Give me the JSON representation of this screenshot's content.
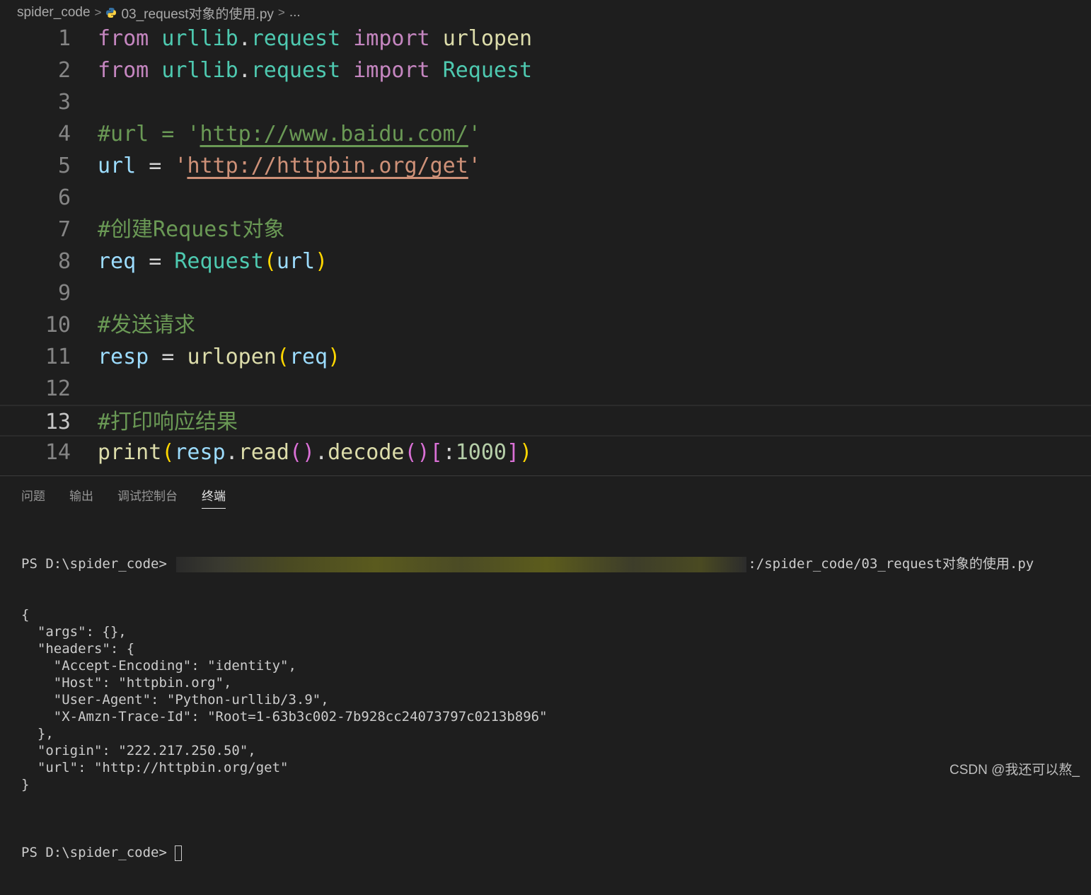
{
  "breadcrumb": {
    "folder": "spider_code",
    "file": "03_request对象的使用.py",
    "more": "...",
    "separator": ">"
  },
  "editor": {
    "current_line": 13,
    "lines": [
      {
        "n": "1",
        "tokens": [
          {
            "t": "from",
            "c": "k"
          },
          {
            "t": " "
          },
          {
            "t": "urllib",
            "c": "m"
          },
          {
            "t": "."
          },
          {
            "t": "request",
            "c": "m"
          },
          {
            "t": " "
          },
          {
            "t": "import",
            "c": "k"
          },
          {
            "t": " "
          },
          {
            "t": "urlopen",
            "c": "f"
          }
        ]
      },
      {
        "n": "2",
        "tokens": [
          {
            "t": "from",
            "c": "k"
          },
          {
            "t": " "
          },
          {
            "t": "urllib",
            "c": "m"
          },
          {
            "t": "."
          },
          {
            "t": "request",
            "c": "m"
          },
          {
            "t": " "
          },
          {
            "t": "import",
            "c": "k"
          },
          {
            "t": " "
          },
          {
            "t": "Request",
            "c": "m"
          }
        ]
      },
      {
        "n": "3",
        "tokens": []
      },
      {
        "n": "4",
        "tokens": [
          {
            "t": "#url = '",
            "c": "c"
          },
          {
            "t": "http://www.baidu.com/",
            "c": "c link-g"
          },
          {
            "t": "'",
            "c": "c"
          }
        ]
      },
      {
        "n": "5",
        "tokens": [
          {
            "t": "url",
            "c": "v"
          },
          {
            "t": " = "
          },
          {
            "t": "'",
            "c": "s"
          },
          {
            "t": "http://httpbin.org/get",
            "c": "s link-s"
          },
          {
            "t": "'",
            "c": "s"
          }
        ]
      },
      {
        "n": "6",
        "tokens": []
      },
      {
        "n": "7",
        "tokens": [
          {
            "t": "#创建Request对象",
            "c": "c"
          }
        ]
      },
      {
        "n": "8",
        "tokens": [
          {
            "t": "req",
            "c": "v"
          },
          {
            "t": " = "
          },
          {
            "t": "Request",
            "c": "m"
          },
          {
            "t": "(",
            "c": "p1"
          },
          {
            "t": "url",
            "c": "v"
          },
          {
            "t": ")",
            "c": "p1"
          }
        ]
      },
      {
        "n": "9",
        "tokens": []
      },
      {
        "n": "10",
        "tokens": [
          {
            "t": "#发送请求",
            "c": "c"
          }
        ]
      },
      {
        "n": "11",
        "tokens": [
          {
            "t": "resp",
            "c": "v"
          },
          {
            "t": " = "
          },
          {
            "t": "urlopen",
            "c": "f"
          },
          {
            "t": "(",
            "c": "p1"
          },
          {
            "t": "req",
            "c": "v"
          },
          {
            "t": ")",
            "c": "p1"
          }
        ]
      },
      {
        "n": "12",
        "tokens": []
      },
      {
        "n": "13",
        "tokens": [
          {
            "t": "#打印响应结果",
            "c": "c"
          }
        ]
      },
      {
        "n": "14",
        "tokens": [
          {
            "t": "print",
            "c": "f"
          },
          {
            "t": "(",
            "c": "p1"
          },
          {
            "t": "resp",
            "c": "v"
          },
          {
            "t": "."
          },
          {
            "t": "read",
            "c": "f"
          },
          {
            "t": "()",
            "c": "p2"
          },
          {
            "t": "."
          },
          {
            "t": "decode",
            "c": "f"
          },
          {
            "t": "()",
            "c": "p2"
          },
          {
            "t": "[",
            "c": "p2"
          },
          {
            "t": ":"
          },
          {
            "t": "1000",
            "c": "n"
          },
          {
            "t": "]",
            "c": "p2"
          },
          {
            "t": ")",
            "c": "p1"
          }
        ]
      }
    ]
  },
  "panel": {
    "tabs": [
      {
        "label": "问题",
        "active": false
      },
      {
        "label": "输出",
        "active": false
      },
      {
        "label": "调试控制台",
        "active": false
      },
      {
        "label": "终端",
        "active": true
      }
    ]
  },
  "terminal": {
    "prompt": "PS D:\\spider_code>",
    "command_tail": ":/spider_code/03_request对象的使用.py",
    "output": [
      "{",
      "  \"args\": {},",
      "  \"headers\": {",
      "    \"Accept-Encoding\": \"identity\",",
      "    \"Host\": \"httpbin.org\",",
      "    \"User-Agent\": \"Python-urllib/3.9\",",
      "    \"X-Amzn-Trace-Id\": \"Root=1-63b3c002-7b928cc24073797c0213b896\"",
      "  },",
      "  \"origin\": \"222.217.250.50\",",
      "  \"url\": \"http://httpbin.org/get\"",
      "}",
      ""
    ],
    "final_prompt": "PS D:\\spider_code>"
  },
  "watermark": "CSDN @我还可以熬_"
}
